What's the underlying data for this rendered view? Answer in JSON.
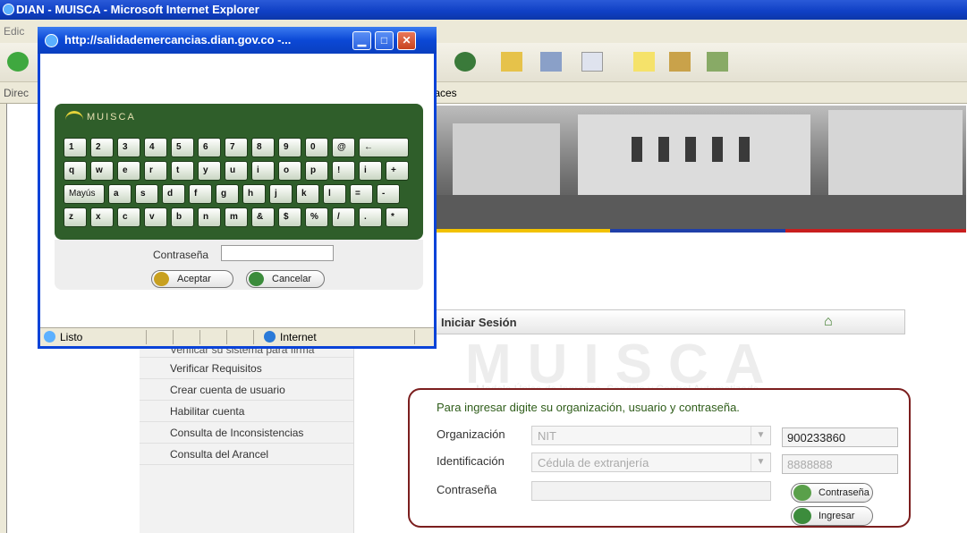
{
  "background_window": {
    "title": "DIAN - MUISCA - Microsoft Internet Explorer",
    "menu_partial": "Edic",
    "address_label": "Direc",
    "address_text": "faces"
  },
  "login": {
    "header": "Iniciar Sesión",
    "watermark": "MUISCA",
    "watermark_subtitle": "Modelo Único de Ingresos, Servicio y Control Automatizado",
    "intro": "Para ingresar digite su organización, usuario y contraseña.",
    "organizacion_label": "Organización",
    "organizacion_select": "NIT",
    "organizacion_value": "900233860",
    "identificacion_label": "Identificación",
    "identificacion_select": "Cédula de extranjería",
    "identificacion_value": "8888888",
    "contrasena_label": "Contraseña",
    "contrasena_button": "Contraseña",
    "ingresar_button": "Ingresar"
  },
  "side_menu": {
    "items": [
      "Verificar su sistema para firma",
      "Verificar Requisitos",
      "Crear cuenta de usuario",
      "Habilitar cuenta",
      "Consulta de Inconsistencias",
      "Consulta del Arancel"
    ]
  },
  "popup": {
    "title": "http://salidademercancias.dian.gov.co -...",
    "keyboard_logo": "MUISCA",
    "keyboard_rows": [
      [
        "1",
        "2",
        "3",
        "4",
        "5",
        "6",
        "7",
        "8",
        "9",
        "0",
        "@",
        "←"
      ],
      [
        "q",
        "w",
        "e",
        "r",
        "t",
        "y",
        "u",
        "i",
        "o",
        "p",
        "!",
        "i",
        "+"
      ],
      [
        "Mayús",
        "a",
        "s",
        "d",
        "f",
        "g",
        "h",
        "j",
        "k",
        "l",
        "=",
        "-"
      ],
      [
        "z",
        "x",
        "c",
        "v",
        "b",
        "n",
        "m",
        "&",
        "$",
        "%",
        "/",
        ".",
        "*"
      ]
    ],
    "password_label": "Contraseña",
    "accept_button": "Aceptar",
    "cancel_button": "Cancelar",
    "status_left": "Listo",
    "status_zone": "Internet"
  }
}
